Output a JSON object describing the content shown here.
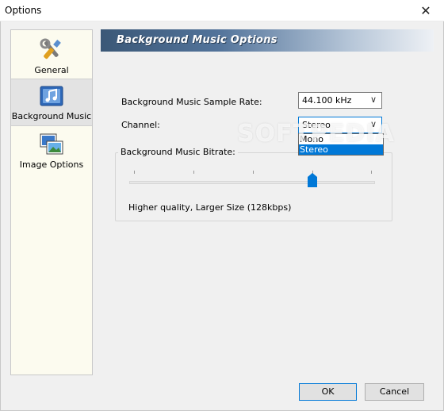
{
  "window": {
    "title": "Options",
    "close_glyph": "✕"
  },
  "sidebar": {
    "items": [
      {
        "label": "General",
        "icon": "tools-icon",
        "selected": false
      },
      {
        "label": "Background Music",
        "icon": "music-note-icon",
        "selected": true
      },
      {
        "label": "Image Options",
        "icon": "images-icon",
        "selected": false
      }
    ]
  },
  "section": {
    "title": "Background Music Options"
  },
  "sample_rate": {
    "label": "Background Music Sample Rate:",
    "value": "44.100 kHz"
  },
  "channel": {
    "label": "Channel:",
    "value": "Stereo",
    "options": [
      "Mono",
      "Stereo"
    ],
    "highlighted": "Stereo"
  },
  "bitrate": {
    "group_label": "Background Music Bitrate:",
    "slider_position": 0.75,
    "quality_text": "Higher quality, Larger Size (128kbps)"
  },
  "watermark": "SOFTPEDIA",
  "buttons": {
    "ok": "OK",
    "cancel": "Cancel"
  },
  "colors": {
    "accent": "#0078d7",
    "sidebar_bg": "#fcfbef",
    "header_dark": "#3b5877"
  }
}
